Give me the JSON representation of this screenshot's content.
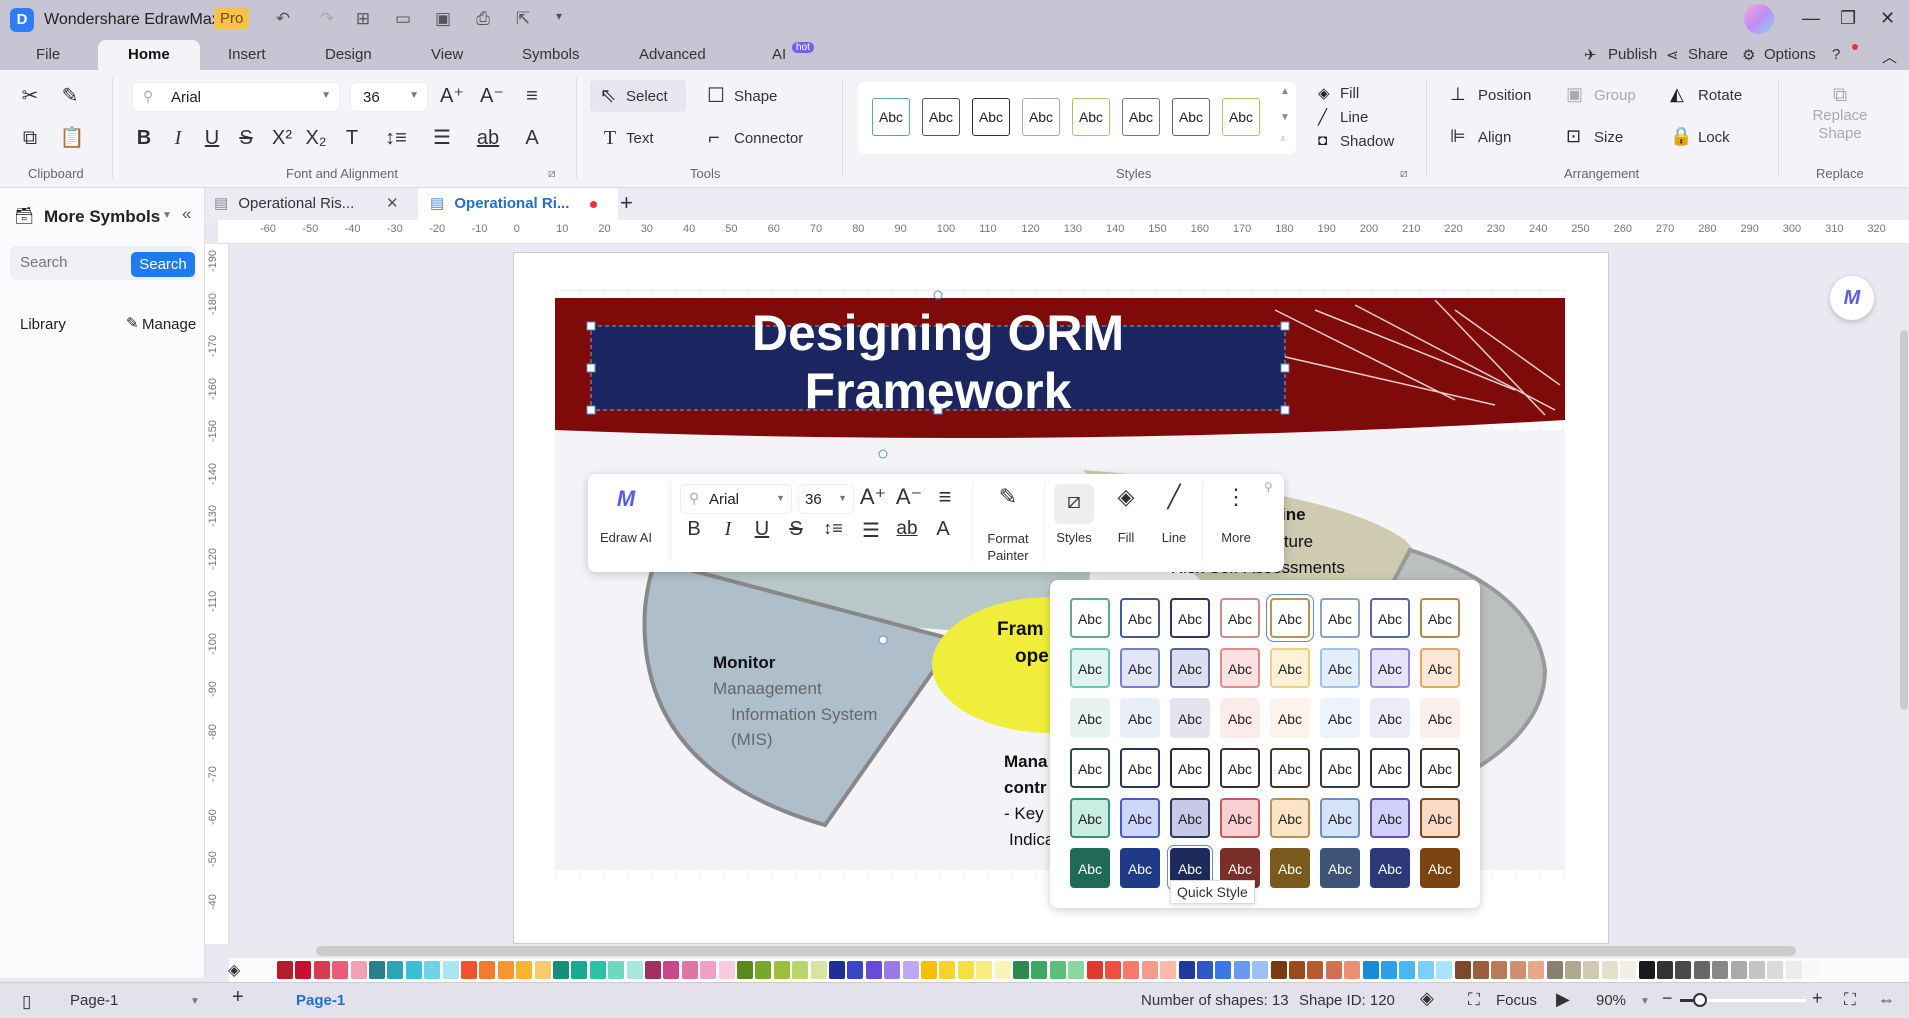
{
  "app": {
    "title": "Wondershare EdrawMax",
    "badge": "Pro"
  },
  "menu": {
    "tabs": [
      "File",
      "Home",
      "Insert",
      "Design",
      "View",
      "Symbols",
      "Advanced",
      "AI"
    ],
    "ai_badge": "hot",
    "right": {
      "publish": "Publish",
      "share": "Share",
      "options": "Options"
    }
  },
  "ribbon": {
    "font_name": "Arial",
    "font_size": "36",
    "select": "Select",
    "shape": "Shape",
    "text": "Text",
    "connector": "Connector",
    "fill": "Fill",
    "line": "Line",
    "shadow": "Shadow",
    "position": "Position",
    "group": "Group",
    "rotate": "Rotate",
    "align": "Align",
    "size": "Size",
    "lock": "Lock",
    "replace_shape": "Replace Shape",
    "style_sample": "Abc",
    "groups": {
      "clipboard": "Clipboard",
      "font": "Font and Alignment",
      "tools": "Tools",
      "styles": "Styles",
      "arrangement": "Arrangement",
      "replace": "Replace"
    },
    "style_border_colors": [
      "#5fa79a",
      "#555",
      "#333",
      "#aaa",
      "#c9b76a",
      "#777",
      "#666",
      "#c9b76a"
    ]
  },
  "sidebar": {
    "title": "More Symbols",
    "search_placeholder": "Search",
    "search_button": "Search",
    "library": "Library",
    "manage": "Manage"
  },
  "doc_tabs": [
    {
      "label": "Operational Ris...",
      "active": false
    },
    {
      "label": "Operational Ri...",
      "active": true
    }
  ],
  "rulers": {
    "h_ticks": [
      "-60",
      "-50",
      "-40",
      "-30",
      "-20",
      "-10",
      "0",
      "10",
      "20",
      "30",
      "40",
      "50",
      "60",
      "70",
      "80",
      "90",
      "100",
      "110",
      "120",
      "130",
      "140",
      "150",
      "160",
      "170",
      "180",
      "190",
      "200",
      "210",
      "220",
      "230",
      "240",
      "250",
      "260",
      "270",
      "280",
      "290",
      "300",
      "310",
      "320"
    ],
    "v_ticks": [
      "-190",
      "-180",
      "-170",
      "-160",
      "-150",
      "-140",
      "-130",
      "-120",
      "-110",
      "-100",
      "-90",
      "-80",
      "-70",
      "-60",
      "-50",
      "-40"
    ]
  },
  "diagram": {
    "title_line1": "Designing ORM",
    "title_line2": "Framework",
    "monitor_title": "Monitor",
    "monitor_line1": "Manaagement",
    "monitor_line2": "Information System",
    "monitor_line3": "(MIS)",
    "center_line1": "Fram",
    "center_line2": "ope",
    "bottom_line1": "Mana",
    "bottom_line2": "contr",
    "bottom_line3": "- Key",
    "bottom_line4": "Indica",
    "right_line1": "ine",
    "right_line2": "structure",
    "right_line3": "Risk Self-Assessments"
  },
  "floating_toolbar": {
    "edraw_ai": "Edraw AI",
    "font_name": "Arial",
    "font_size": "36",
    "format_painter": "Format Painter",
    "styles": "Styles",
    "fill": "Fill",
    "line": "Line",
    "more": "More"
  },
  "quick_style": {
    "sample": "Abc",
    "tooltip": "Quick Style",
    "rows": [
      {
        "fill": [
          "#fff",
          "#fff",
          "#fff",
          "#fff",
          "#fff",
          "#fff",
          "#fff",
          "#fff"
        ],
        "border": [
          "#5fa79a",
          "#4b5a8c",
          "#2e3560",
          "#d28c8c",
          "#b8945a",
          "#8aa0c0",
          "#5d63a8",
          "#b08a4a"
        ],
        "text": "#222"
      },
      {
        "fill": [
          "#e0f5f1",
          "#e2e6f8",
          "#dcdff0",
          "#fbe1e1",
          "#fdf1d8",
          "#e3eefb",
          "#e6e4fb",
          "#fbe8d8"
        ],
        "border": [
          "#6cc7b4",
          "#7080d0",
          "#5a5f9a",
          "#e08a8a",
          "#f2cf80",
          "#9fc0e8",
          "#8c86e0",
          "#e0a860"
        ],
        "text": "#222"
      },
      {
        "fill": [
          "#e8f3f0",
          "#eaedfa",
          "#e4e4ee",
          "#fcebeb",
          "#fcf4ea",
          "#edf3fb",
          "#ececf9",
          "#fceeea"
        ],
        "border": [
          "transparent",
          "transparent",
          "transparent",
          "transparent",
          "transparent",
          "transparent",
          "transparent",
          "transparent"
        ],
        "text": "#222"
      },
      {
        "fill": [
          "#fff",
          "#fff",
          "#fff",
          "#fff",
          "#fff",
          "#fff",
          "#fff",
          "#fff"
        ],
        "border": [
          "#2f4a44",
          "#2e3552",
          "#2a2c3d",
          "#3f2f2f",
          "#3f3827",
          "#333b47",
          "#30324a",
          "#3f3324"
        ],
        "text": "#222"
      },
      {
        "fill": [
          "#c9ece3",
          "#cfd6fb",
          "#c7c9e6",
          "#fbd0d3",
          "#fde4c4",
          "#d6e4fb",
          "#d2cffb",
          "#fcd9c4"
        ],
        "border": [
          "#3b8f7d",
          "#4a5dc0",
          "#2e3560",
          "#c25c5c",
          "#b8945a",
          "#6f8fbf",
          "#5a55b5",
          "#7a4a20"
        ],
        "text": "#222"
      },
      {
        "fill": [
          "#1f6b58",
          "#1f3a86",
          "#1f2a5c",
          "#7a2f2a",
          "#7a5a1f",
          "#3d5478",
          "#2d3a7a",
          "#7a4410"
        ],
        "border": [
          "#1f6b58",
          "#1f3a86",
          "#1f2a5c",
          "#7a2f2a",
          "#7a5a1f",
          "#3d5478",
          "#2d3a7a",
          "#7a4410"
        ],
        "text": "#fff"
      }
    ]
  },
  "palette": [
    "#b51c2a",
    "#c8102e",
    "#d83a4e",
    "#e85d75",
    "#f4a0b0",
    "#2a7f8c",
    "#2fa3b8",
    "#39bfd6",
    "#6fd3e6",
    "#a8e6f2",
    "#f0522e",
    "#f47a2e",
    "#f79530",
    "#f9b42e",
    "#fbc96a",
    "#168f7a",
    "#1aa890",
    "#2cc0a4",
    "#6fd6c2",
    "#a8e8da",
    "#a0305f",
    "#c8488a",
    "#e073a8",
    "#f0a0c8",
    "#f6cce0",
    "#5a8a1e",
    "#78a82a",
    "#98c03a",
    "#b8d66a",
    "#d6e6a0",
    "#1e2f9a",
    "#3a46c8",
    "#6a4ad6",
    "#9a7ae6",
    "#c0a8f0",
    "#f6c000",
    "#f8d22e",
    "#f4e040",
    "#f8ec80",
    "#fbf4b8",
    "#2e8a4a",
    "#3fa860",
    "#5cc07a",
    "#8cd6a0",
    "#e03a2e",
    "#f0503e",
    "#f47a6a",
    "#f89a8a",
    "#fbb8ac",
    "#1e3a9a",
    "#2e58c8",
    "#3a78e6",
    "#6a9af0",
    "#9ac0f6",
    "#7a3a10",
    "#9a4a1a",
    "#b85a30",
    "#d07050",
    "#e89070",
    "#1a88d6",
    "#2ea0e6",
    "#4ab8f0",
    "#7ad0f8",
    "#a8e4fb",
    "#7a4a2a",
    "#9a5e3a",
    "#b87a5a",
    "#d09070",
    "#e8a888",
    "#8a8070",
    "#b0a890",
    "#cfc9b0",
    "#e4e0cc",
    "#f2f0e4",
    "#1a1a1a",
    "#333",
    "#4a4a4a",
    "#666",
    "#888",
    "#aaa",
    "#c4c4c4",
    "#dadada",
    "#ececec",
    "#f8f8f8"
  ],
  "status": {
    "page_select": "Page-1",
    "page_tab": "Page-1",
    "num_shapes": "Number of shapes: 13",
    "shape_id": "Shape ID: 120",
    "focus": "Focus",
    "zoom": "90%",
    "zoom_level": 0.5
  }
}
